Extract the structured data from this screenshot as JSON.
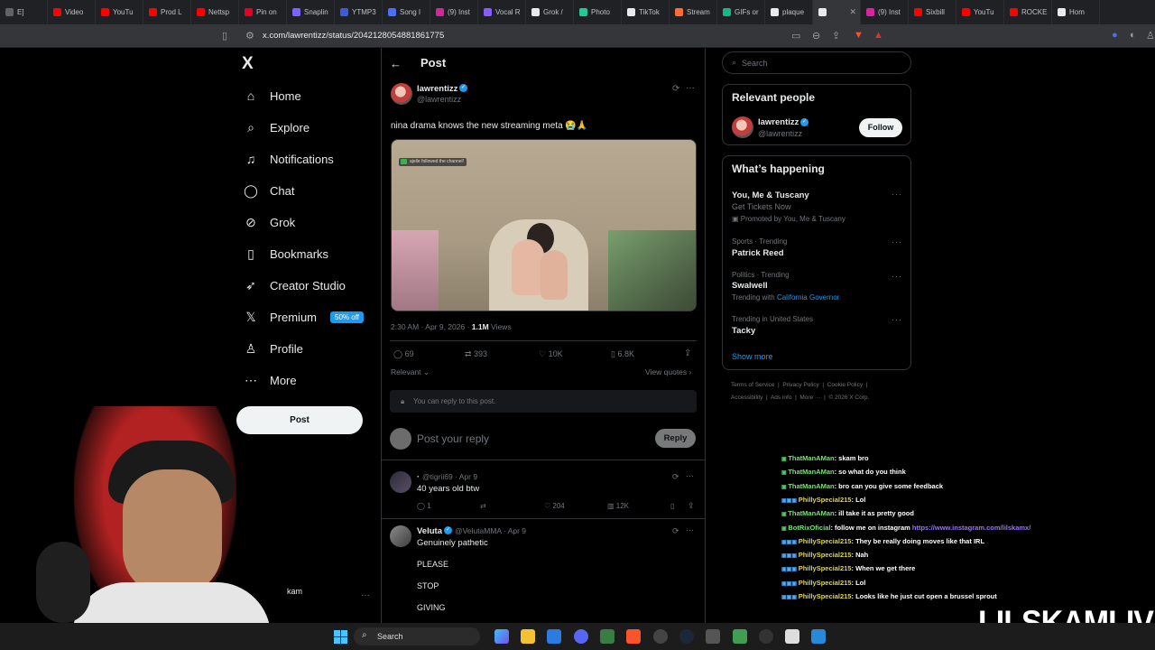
{
  "browser": {
    "tabs": [
      {
        "label": "E]",
        "color": "#5f6368"
      },
      {
        "label": "Video",
        "color": "#ff0000"
      },
      {
        "label": "YouTu",
        "color": "#ff0000"
      },
      {
        "label": "Prod L",
        "color": "#ff0000"
      },
      {
        "label": "Nettsp",
        "color": "#ff0000"
      },
      {
        "label": "Pin on",
        "color": "#e60023"
      },
      {
        "label": "Snaplin",
        "color": "#7b61ff"
      },
      {
        "label": "YTMP3",
        "color": "#3b5bdb"
      },
      {
        "label": "Song I",
        "color": "#4c6ef5"
      },
      {
        "label": "(9) Inst",
        "color": "#d6249f"
      },
      {
        "label": "Vocal R",
        "color": "#845ef7"
      },
      {
        "label": "Grok /",
        "color": "#e8eaed"
      },
      {
        "label": "Photo",
        "color": "#20c997"
      },
      {
        "label": "TikTok",
        "color": "#e8eaed"
      },
      {
        "label": "Stream",
        "color": "#ff6b35"
      },
      {
        "label": "GIFs or",
        "color": "#12b886"
      },
      {
        "label": "plaque",
        "color": "#e8eaed"
      },
      {
        "label": "",
        "color": "#e8eaed",
        "active": true
      },
      {
        "label": "(9) Inst",
        "color": "#d6249f"
      },
      {
        "label": "Sixbill",
        "color": "#ff0000"
      },
      {
        "label": "YouTu",
        "color": "#ff0000"
      },
      {
        "label": "ROCKE",
        "color": "#ff0000"
      },
      {
        "label": "Hom",
        "color": "#e8eaed"
      }
    ],
    "url": "x.com/lawrentizz/status/2042128054881861775"
  },
  "nav": {
    "logo": "X",
    "items": [
      {
        "label": "Home",
        "icon": "home-icon",
        "glyph": "⌂"
      },
      {
        "label": "Explore",
        "icon": "search-icon",
        "glyph": "⌕"
      },
      {
        "label": "Notifications",
        "icon": "bell-icon",
        "glyph": "♫"
      },
      {
        "label": "Chat",
        "icon": "chat-icon",
        "glyph": "◯"
      },
      {
        "label": "Grok",
        "icon": "grok-icon",
        "glyph": "⊘"
      },
      {
        "label": "Bookmarks",
        "icon": "bookmark-icon",
        "glyph": "▯"
      },
      {
        "label": "Creator Studio",
        "icon": "rocket-icon",
        "glyph": "➶"
      },
      {
        "label": "Premium",
        "icon": "x-premium-icon",
        "glyph": "𝕏"
      },
      {
        "label": "Profile",
        "icon": "profile-icon",
        "glyph": "♙"
      },
      {
        "label": "More",
        "icon": "more-icon",
        "glyph": "⋯"
      }
    ],
    "premium_badge": "50% off",
    "post_button": "Post",
    "account_name": "kam",
    "account_more": "···"
  },
  "post": {
    "header_title": "Post",
    "back_glyph": "←",
    "author_name": "lawrentizz",
    "author_handle": "@lawrentizz",
    "text": "nina drama knows the new streaming meta 😭🙏",
    "video_overlay_text": "ajelle followed the channel!",
    "timestamp": "2:30 AM · Apr 9, 2026 · ",
    "views_count": "1.1M",
    "views_label": " Views",
    "stats": {
      "replies": "69",
      "reposts": "393",
      "likes": "10K",
      "bookmarks": "6.8K"
    },
    "sort_label": "Relevant",
    "view_quotes": "View quotes",
    "reply_notice": "You can reply to this post.",
    "reply_placeholder": "Post your reply",
    "reply_button": "Reply"
  },
  "replies": [
    {
      "name": "·",
      "handle": "@tigrii69 · Apr 9",
      "text": "40 years old btw",
      "replies": "1",
      "likes": "204",
      "views": "12K"
    },
    {
      "name": "Veluta",
      "handle": "@VelutaMMA · Apr 9",
      "text": "Genuinely pathetic",
      "lines": [
        "PLEASE",
        "STOP",
        "GIVING"
      ]
    }
  ],
  "sidebar": {
    "search_placeholder": "Search",
    "relevant_title": "Relevant people",
    "person_name": "lawrentizz",
    "person_handle": "@lawrentizz",
    "follow_button": "Follow",
    "happening_title": "What’s happening",
    "trends": [
      {
        "title": "You, Me & Tuscany",
        "sub": "Get Tickets Now",
        "promo": "Promoted by You, Me & Tuscany"
      },
      {
        "meta": "Sports · Trending",
        "title": "Patrick Reed"
      },
      {
        "meta": "Politics · Trending",
        "title": "Swalwell",
        "sub_prefix": "Trending with ",
        "sub_link": "California Governor"
      },
      {
        "meta": "Trending in United States",
        "title": "Tacky"
      }
    ],
    "show_more": "Show more",
    "footer_line1": [
      "Terms of Service",
      "Privacy Policy",
      "Cookie Policy"
    ],
    "footer_line2": [
      "Accessibility",
      "Ads info",
      "More ···",
      "© 2026 X Corp."
    ]
  },
  "chat": [
    {
      "user": "ThatManAMan",
      "msg": ": skam bro",
      "style": "green"
    },
    {
      "user": "ThatManAMan",
      "msg": ": so what do you think",
      "style": "green"
    },
    {
      "user": "ThatManAMan",
      "msg": ": bro can you give some feedback",
      "style": "green"
    },
    {
      "user": "PhillySpecial215",
      "msg": ": Lol",
      "style": "yellow"
    },
    {
      "user": "ThatManAMan",
      "msg": ":  ill take it as pretty good",
      "style": "green"
    },
    {
      "user": "BotRixOficial",
      "msg": ": follow me on instagram ",
      "link": "https://www.instagram.com/lilskamx/",
      "style": "green"
    },
    {
      "user": "PhillySpecial215",
      "msg": ": They be really doing moves like that IRL",
      "style": "yellow"
    },
    {
      "user": "PhillySpecial215",
      "msg": ": Nah",
      "style": "yellow"
    },
    {
      "user": "PhillySpecial215",
      "msg": ": When we get there",
      "style": "yellow"
    },
    {
      "user": "PhillySpecial215",
      "msg": ": Lol",
      "style": "yellow"
    },
    {
      "user": "PhillySpecial215",
      "msg": ": Looks like he just cut open a brussel sprout",
      "style": "yellow"
    }
  ],
  "stream_watermark": "LILSKAMLIVE",
  "taskbar": {
    "search_label": "Search"
  }
}
